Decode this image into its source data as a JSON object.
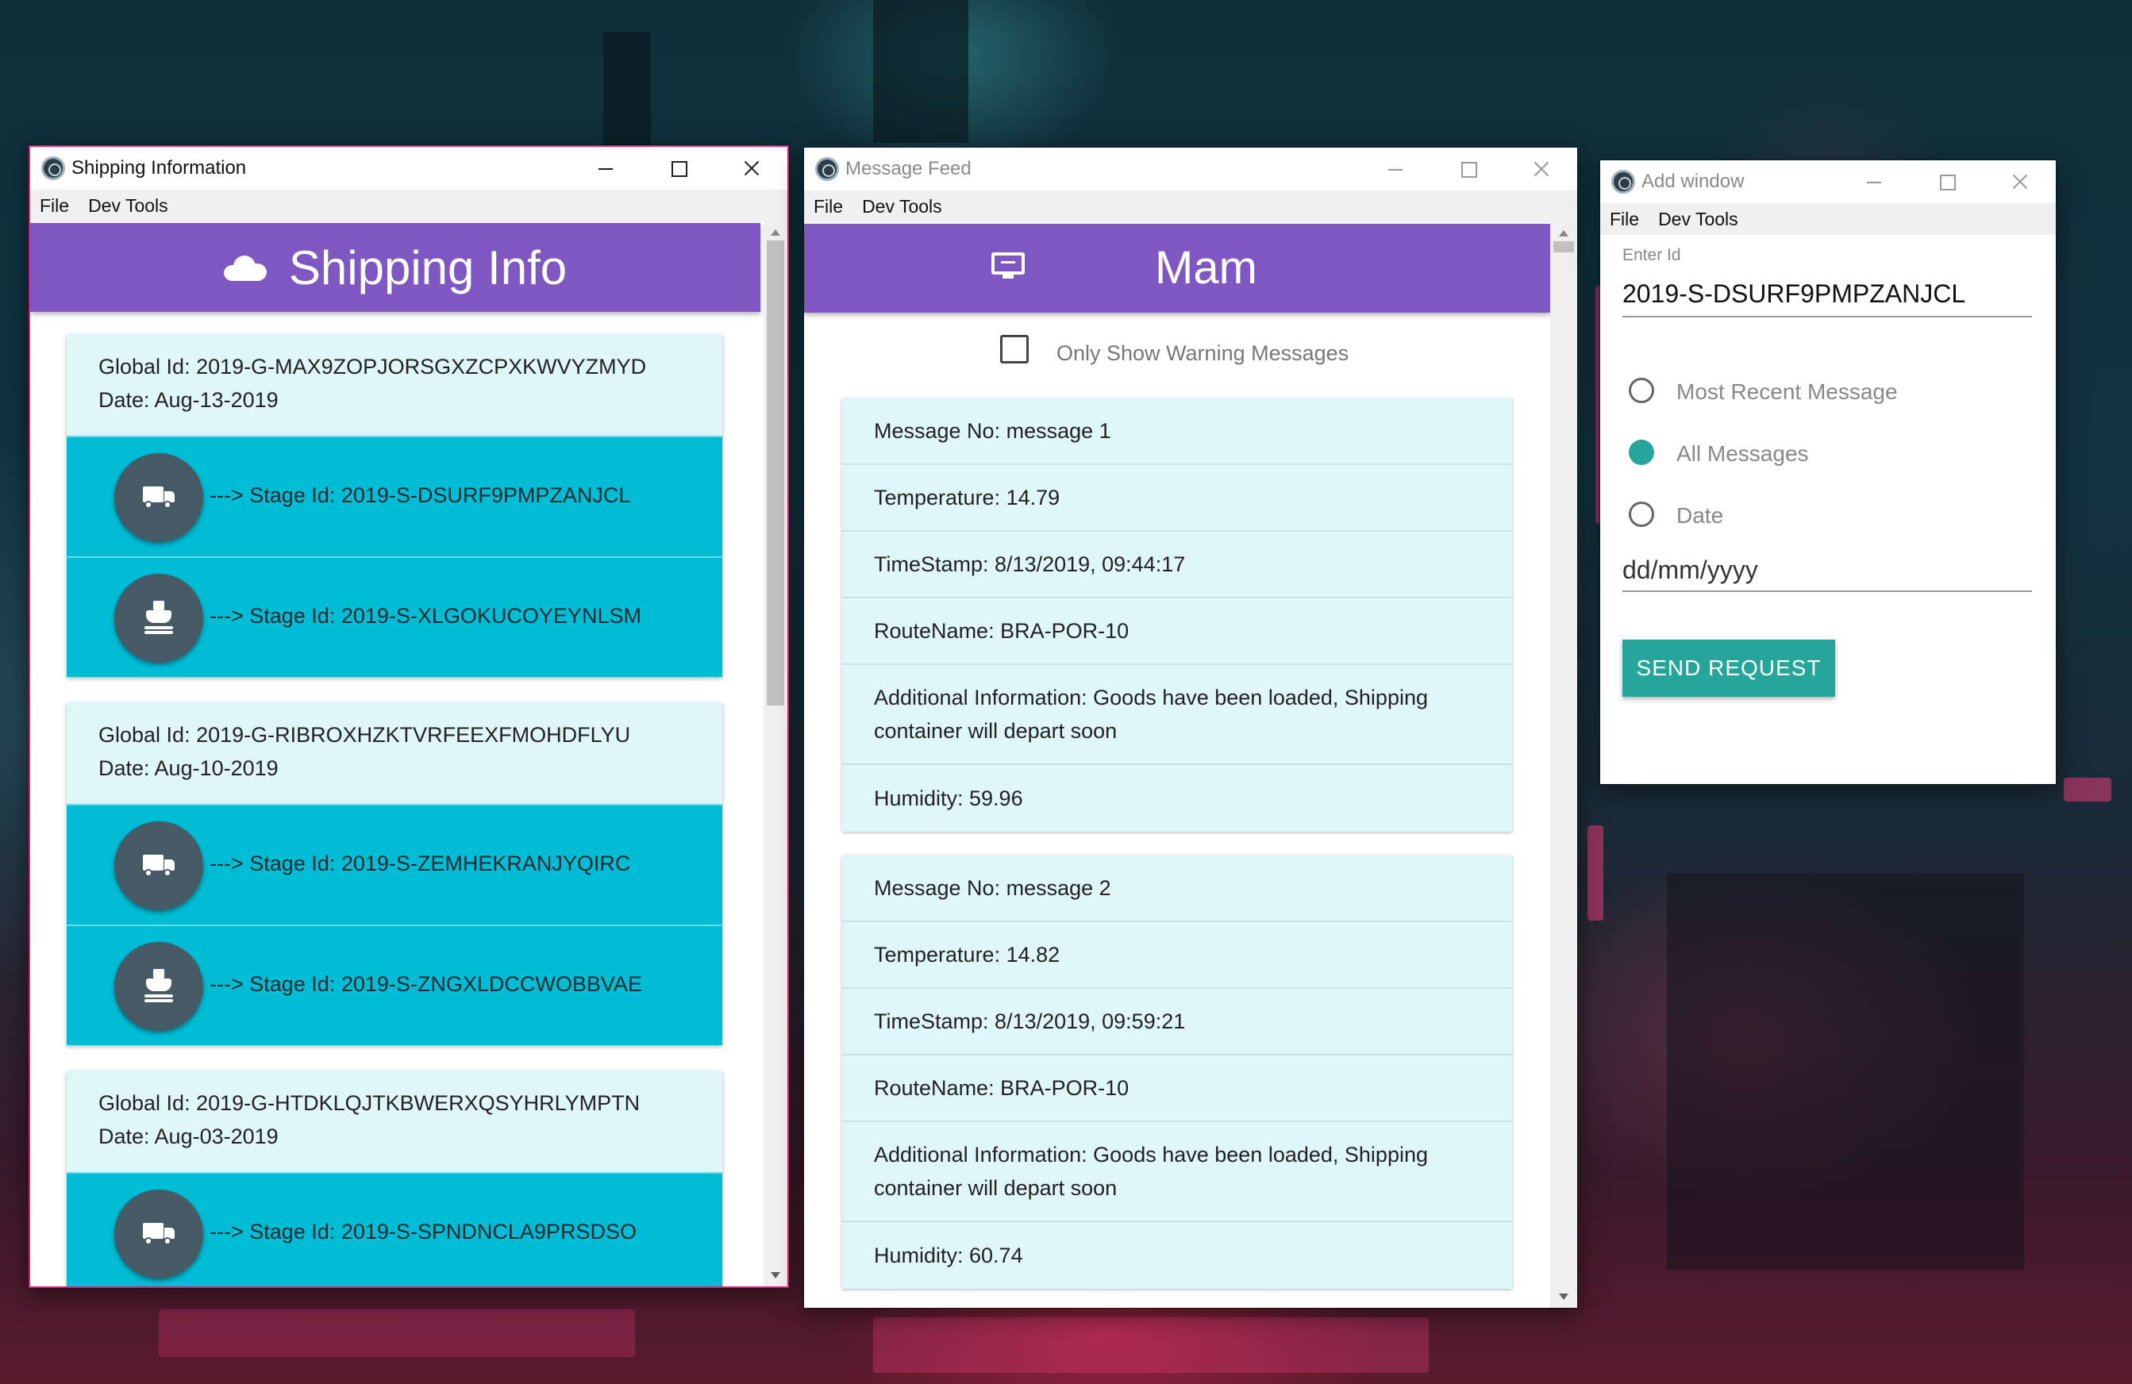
{
  "shipping_window": {
    "title": "Shipping Information",
    "menu": [
      "File",
      "Dev Tools"
    ],
    "header": "Shipping Info",
    "shipments": [
      {
        "global_id": "Global Id: 2019-G-MAX9ZOPJORSGXZCPXKWVYZMYD",
        "date": "Date: Aug-13-2019",
        "stages": [
          {
            "icon": "truck-icon",
            "text": "---> Stage Id: 2019-S-DSURF9PMPZANJCL"
          },
          {
            "icon": "ship-icon",
            "text": "---> Stage Id: 2019-S-XLGOKUCOYEYNLSM"
          }
        ]
      },
      {
        "global_id": "Global Id: 2019-G-RIBROXHZKTVRFEEXFMOHDFLYU",
        "date": "Date: Aug-10-2019",
        "stages": [
          {
            "icon": "truck-icon",
            "text": "---> Stage Id: 2019-S-ZEMHEKRANJYQIRC"
          },
          {
            "icon": "ship-icon",
            "text": "---> Stage Id: 2019-S-ZNGXLDCCWOBBVAE"
          }
        ]
      },
      {
        "global_id": "Global Id: 2019-G-HTDKLQJTKBWERXQSYHRLYMPTN",
        "date": "Date: Aug-03-2019",
        "stages": [
          {
            "icon": "truck-icon",
            "text": "---> Stage Id: 2019-S-SPNDNCLA9PRSDSO"
          }
        ]
      }
    ]
  },
  "message_window": {
    "title": "Message Feed",
    "menu": [
      "File",
      "Dev Tools"
    ],
    "header": "Mam",
    "warning_filter_label": "Only Show Warning Messages",
    "messages": [
      {
        "message_no": "Message No: message 1",
        "temperature": "Temperature: 14.79",
        "timestamp": "TimeStamp: 8/13/2019, 09:44:17",
        "route": "RouteName: BRA-POR-10",
        "info": "Additional Information: Goods have been loaded, Shipping container will depart soon",
        "humidity": "Humidity: 59.96"
      },
      {
        "message_no": "Message No: message 2",
        "temperature": "Temperature: 14.82",
        "timestamp": "TimeStamp: 8/13/2019, 09:59:21",
        "route": "RouteName: BRA-POR-10",
        "info": "Additional Information: Goods have been loaded, Shipping container will depart soon",
        "humidity": "Humidity: 60.74"
      }
    ]
  },
  "add_window": {
    "title": "Add window",
    "menu": [
      "File",
      "Dev Tools"
    ],
    "id_label": "Enter Id",
    "id_value": "2019-S-DSURF9PMPZANJCL",
    "options": [
      {
        "label": "Most Recent Message",
        "checked": false
      },
      {
        "label": "All Messages",
        "checked": true
      },
      {
        "label": "Date",
        "checked": false
      }
    ],
    "date_placeholder": "dd/mm/yyyy",
    "send_label": "SEND REQUEST"
  },
  "colors": {
    "header_purple": "#7e57c2",
    "stage_cyan": "#00bcd4",
    "card_light": "#e0f7fa",
    "accent_teal": "#26a69a",
    "active_border": "#e11d74"
  }
}
